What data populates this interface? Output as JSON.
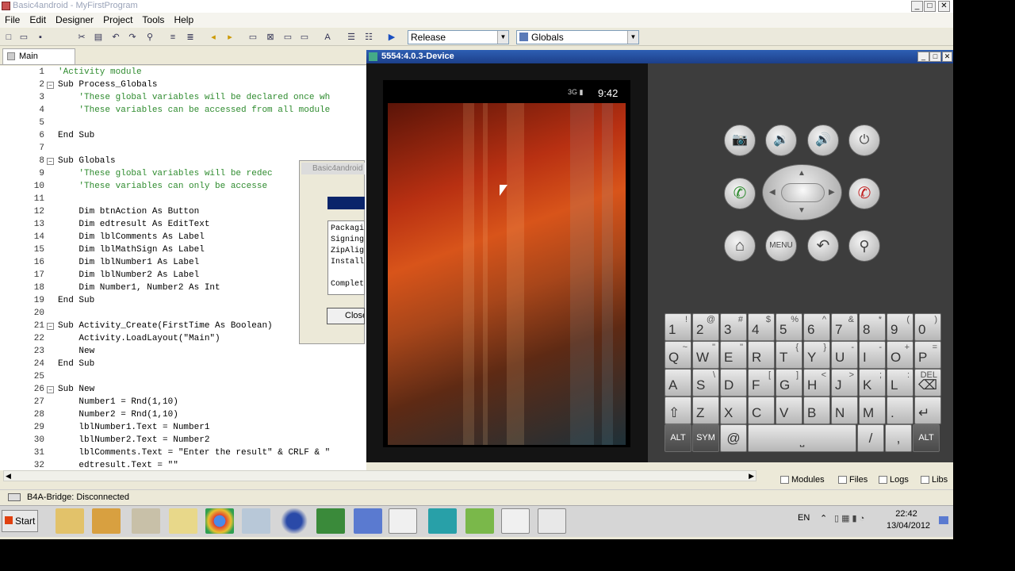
{
  "window": {
    "title": "Basic4android - MyFirstProgram",
    "minimize": "_",
    "maximize": "□",
    "close": "✕"
  },
  "menu": [
    "File",
    "Edit",
    "Designer",
    "Project",
    "Tools",
    "Help"
  ],
  "toolbar": {
    "build_config": "Release",
    "module_combo": "Globals",
    "dropdown_arrow": "▼"
  },
  "tabs": {
    "main": "Main"
  },
  "editor": {
    "lines": [
      {
        "n": "1",
        "t": "'Activity module",
        "c": true,
        "fold": ""
      },
      {
        "n": "2",
        "t": "Sub Process_Globals",
        "c": false,
        "fold": "−"
      },
      {
        "n": "3",
        "t": "    'These global variables will be declared once wh",
        "c": true,
        "fold": ""
      },
      {
        "n": "4",
        "t": "    'These variables can be accessed from all module",
        "c": true,
        "fold": ""
      },
      {
        "n": "5",
        "t": "",
        "c": false,
        "fold": ""
      },
      {
        "n": "6",
        "t": "End Sub",
        "c": false,
        "fold": ""
      },
      {
        "n": "7",
        "t": "",
        "c": false,
        "fold": ""
      },
      {
        "n": "8",
        "t": "Sub Globals",
        "c": false,
        "fold": "−"
      },
      {
        "n": "9",
        "t": "    'These global variables will be redec",
        "c": true,
        "fold": ""
      },
      {
        "n": "10",
        "t": "    'These variables can only be accesse",
        "c": true,
        "fold": ""
      },
      {
        "n": "11",
        "t": "",
        "c": false,
        "fold": ""
      },
      {
        "n": "12",
        "t": "    Dim btnAction As Button",
        "c": false,
        "fold": ""
      },
      {
        "n": "13",
        "t": "    Dim edtresult As EditText",
        "c": false,
        "fold": ""
      },
      {
        "n": "14",
        "t": "    Dim lblComments As Label",
        "c": false,
        "fold": ""
      },
      {
        "n": "15",
        "t": "    Dim lblMathSign As Label",
        "c": false,
        "fold": ""
      },
      {
        "n": "16",
        "t": "    Dim lblNumber1 As Label",
        "c": false,
        "fold": ""
      },
      {
        "n": "17",
        "t": "    Dim lblNumber2 As Label",
        "c": false,
        "fold": ""
      },
      {
        "n": "18",
        "t": "    Dim Number1, Number2 As Int",
        "c": false,
        "fold": ""
      },
      {
        "n": "19",
        "t": "End Sub",
        "c": false,
        "fold": ""
      },
      {
        "n": "20",
        "t": "",
        "c": false,
        "fold": ""
      },
      {
        "n": "21",
        "t": "Sub Activity_Create(FirstTime As Boolean)",
        "c": false,
        "fold": "−"
      },
      {
        "n": "22",
        "t": "    Activity.LoadLayout(\"Main\")",
        "c": false,
        "fold": ""
      },
      {
        "n": "23",
        "t": "    New",
        "c": false,
        "fold": ""
      },
      {
        "n": "24",
        "t": "End Sub",
        "c": false,
        "fold": ""
      },
      {
        "n": "25",
        "t": "",
        "c": false,
        "fold": ""
      },
      {
        "n": "26",
        "t": "Sub New",
        "c": false,
        "fold": "−"
      },
      {
        "n": "27",
        "t": "    Number1 = Rnd(1,10)",
        "c": false,
        "fold": ""
      },
      {
        "n": "28",
        "t": "    Number2 = Rnd(1,10)",
        "c": false,
        "fold": ""
      },
      {
        "n": "29",
        "t": "    lblNumber1.Text = Number1",
        "c": false,
        "fold": ""
      },
      {
        "n": "30",
        "t": "    lblNumber2.Text = Number2",
        "c": false,
        "fold": ""
      },
      {
        "n": "31",
        "t": "    lblComments.Text = \"Enter the result\" & CRLF & \"",
        "c": false,
        "fold": ""
      },
      {
        "n": "32",
        "t": "    edtresult.Text = \"\"",
        "c": false,
        "fold": ""
      }
    ]
  },
  "compile_dialog": {
    "title": "Basic4android",
    "log": "Packagi\nSigning\nZipAlig\nInstall\n\nComplet",
    "close_button": "Close"
  },
  "bottom_tabs": [
    "Modules",
    "Files",
    "Logs",
    "Libs"
  ],
  "status": {
    "bridge": "B4A-Bridge: Disconnected"
  },
  "emulator": {
    "title": "5554:4.0.3-Device",
    "status_bar": {
      "signal": "3G ▮",
      "time": "9:42"
    },
    "hw_buttons": {
      "camera": "📷",
      "vol_down": "🔉",
      "vol_up": "🔊",
      "power": "⏻",
      "call": "✆",
      "end_call": "✆",
      "home": "⌂",
      "menu": "MENU",
      "back": "↶",
      "search": "⚲"
    },
    "dpad": {
      "up": "▲",
      "down": "▼",
      "left": "◀",
      "right": "▶"
    },
    "keyboard": [
      [
        {
          "k": "1",
          "s": "!"
        },
        {
          "k": "2",
          "s": "@"
        },
        {
          "k": "3",
          "s": "#"
        },
        {
          "k": "4",
          "s": "$"
        },
        {
          "k": "5",
          "s": "%"
        },
        {
          "k": "6",
          "s": "^"
        },
        {
          "k": "7",
          "s": "&"
        },
        {
          "k": "8",
          "s": "*"
        },
        {
          "k": "9",
          "s": "("
        },
        {
          "k": "0",
          "s": ")"
        }
      ],
      [
        {
          "k": "Q",
          "s": "~"
        },
        {
          "k": "W",
          "s": "\""
        },
        {
          "k": "E",
          "s": "\""
        },
        {
          "k": "R",
          "s": ""
        },
        {
          "k": "T",
          "s": "{"
        },
        {
          "k": "Y",
          "s": "}"
        },
        {
          "k": "U",
          "s": "-"
        },
        {
          "k": "I",
          "s": "-"
        },
        {
          "k": "O",
          "s": "+"
        },
        {
          "k": "P",
          "s": "="
        }
      ],
      [
        {
          "k": "A",
          "s": ""
        },
        {
          "k": "S",
          "s": "\\"
        },
        {
          "k": "D",
          "s": ""
        },
        {
          "k": "F",
          "s": "["
        },
        {
          "k": "G",
          "s": "]"
        },
        {
          "k": "H",
          "s": "<"
        },
        {
          "k": "J",
          "s": ">"
        },
        {
          "k": "K",
          "s": ";"
        },
        {
          "k": "L",
          "s": ":"
        },
        {
          "k": "⌫",
          "s": "DEL"
        }
      ],
      [
        {
          "k": "⇧",
          "s": ""
        },
        {
          "k": "Z",
          "s": ""
        },
        {
          "k": "X",
          "s": ""
        },
        {
          "k": "C",
          "s": ""
        },
        {
          "k": "V",
          "s": ""
        },
        {
          "k": "B",
          "s": ""
        },
        {
          "k": "N",
          "s": ""
        },
        {
          "k": "M",
          "s": ""
        },
        {
          "k": ".",
          "s": ""
        },
        {
          "k": "↵",
          "s": ""
        }
      ]
    ],
    "bottom_row": {
      "alt_left": "ALT",
      "sym": "SYM",
      "at": "@",
      "space": "⎵",
      "slash": "/",
      "comma": ",",
      "alt_right": "ALT"
    }
  },
  "taskbar": {
    "start": "Start",
    "lang": "EN",
    "time": "22:42",
    "date": "13/04/2012"
  }
}
